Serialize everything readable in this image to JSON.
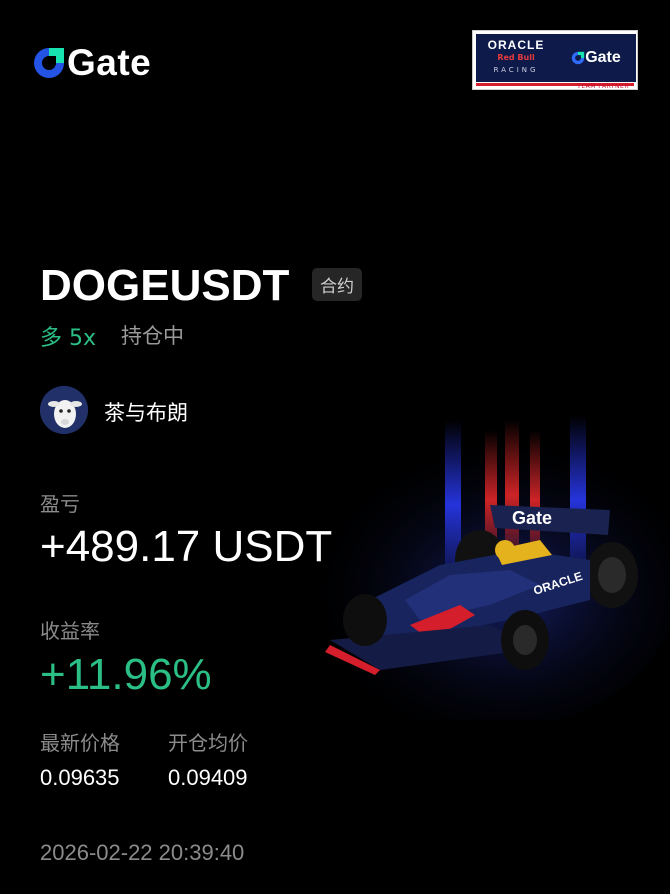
{
  "brand": {
    "logo_text": "Gate"
  },
  "partner_badge": {
    "oracle": "ORACLE",
    "redbull": "Red Bull",
    "racing": "RACING",
    "gate": "Gate",
    "subtitle": "TEAM PARTNER"
  },
  "position": {
    "symbol": "DOGEUSDT",
    "type_tag": "合约",
    "direction": "多 5x",
    "status": "持仓中"
  },
  "user": {
    "nickname": "茶与布朗"
  },
  "pnl": {
    "label": "盈亏",
    "value": "+489.17 USDT"
  },
  "roi": {
    "label": "收益率",
    "value": "+11.96%"
  },
  "prices": {
    "latest_label": "最新价格",
    "latest_value": "0.09635",
    "entry_label": "开仓均价",
    "entry_value": "0.09409"
  },
  "timestamp": "2026-02-22 20:39:40",
  "colors": {
    "accent_green": "#2bbf86",
    "brand_blue": "#2354e6",
    "background": "#000000"
  }
}
